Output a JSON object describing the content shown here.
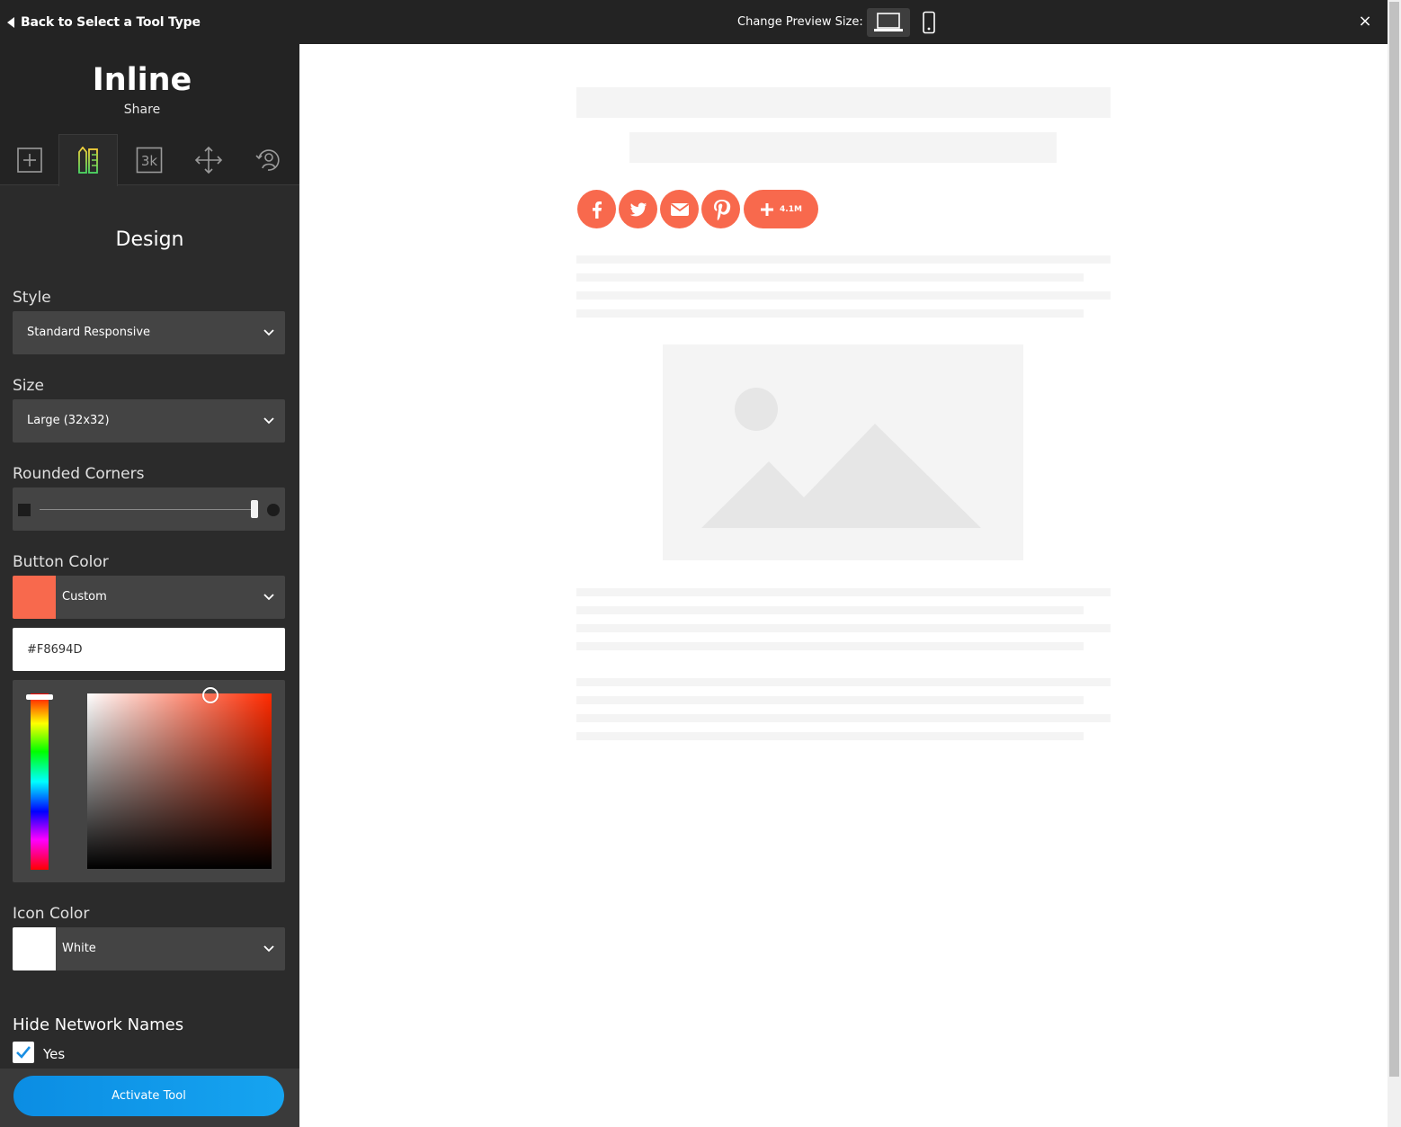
{
  "topbar": {
    "back_label": "Back to Select a Tool Type",
    "preview_label": "Change Preview Size:",
    "close_icon": "×"
  },
  "sidebar": {
    "title": "Inline",
    "subtitle": "Share",
    "tabs": [
      {
        "icon": "plus-square-icon",
        "active": false
      },
      {
        "icon": "design-pencil-ruler-icon",
        "active": true
      },
      {
        "icon": "counter-3k-icon",
        "label": "3k",
        "active": false
      },
      {
        "icon": "move-arrows-icon",
        "active": false
      },
      {
        "icon": "user-target-icon",
        "active": false
      }
    ],
    "section_title": "Design",
    "style": {
      "label": "Style",
      "value": "Standard Responsive"
    },
    "size": {
      "label": "Size",
      "value": "Large (32x32)"
    },
    "rounded_corners": {
      "label": "Rounded Corners",
      "value_percent": 100
    },
    "button_color": {
      "label": "Button Color",
      "value": "Custom",
      "swatch": "#F8694D",
      "hex": "#F8694D"
    },
    "icon_color": {
      "label": "Icon Color",
      "value": "White",
      "swatch": "#FFFFFF"
    },
    "hide_network_names": {
      "label": "Hide Network Names",
      "option": "Yes",
      "checked": true
    },
    "activate_label": "Activate Tool"
  },
  "preview": {
    "share_buttons": [
      {
        "network": "facebook",
        "icon": "facebook-icon"
      },
      {
        "network": "twitter",
        "icon": "twitter-icon"
      },
      {
        "network": "email",
        "icon": "envelope-icon"
      },
      {
        "network": "pinterest",
        "icon": "pinterest-icon"
      }
    ],
    "share_count": "4.1M",
    "accent": "#F8694D"
  }
}
